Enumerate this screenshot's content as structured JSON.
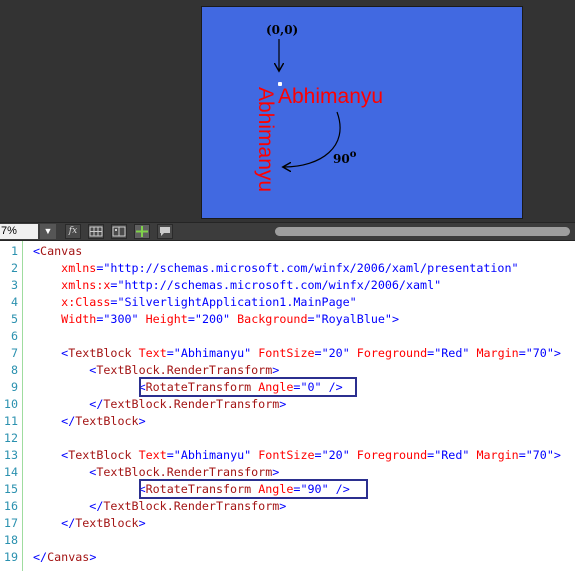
{
  "designer": {
    "origin_label": "(0,0)",
    "text_horizontal": "Abhimanyu",
    "text_vertical": "Abhimanyu",
    "angle_value": "90",
    "angle_degree_mark": "o",
    "colors": {
      "canvas_background": "#4169e1",
      "text_foreground": "#ff0000",
      "annotation": "#000000"
    }
  },
  "toolbar": {
    "zoom_value": "7%",
    "icons": [
      "dropdown-icon",
      "fx-icon",
      "grid-icon",
      "grid-split-icon",
      "snap-icon",
      "comment-icon"
    ]
  },
  "editor": {
    "line_numbers": [
      "1",
      "2",
      "3",
      "4",
      "5",
      "6",
      "7",
      "8",
      "9",
      "10",
      "11",
      "12",
      "13",
      "14",
      "15",
      "16",
      "17",
      "18",
      "19"
    ],
    "lines": [
      {
        "ln": "1",
        "indent": "",
        "tokens": [
          [
            "<",
            "punct"
          ],
          [
            "Canvas",
            "tag"
          ]
        ]
      },
      {
        "ln": "2",
        "indent": "    ",
        "tokens": [
          [
            "xmlns",
            "attr"
          ],
          [
            "=",
            "punct"
          ],
          [
            "\"http://schemas.microsoft.com/winfx/2006/xaml/presentation\"",
            "val"
          ]
        ]
      },
      {
        "ln": "3",
        "indent": "    ",
        "tokens": [
          [
            "xmlns:x",
            "attr"
          ],
          [
            "=",
            "punct"
          ],
          [
            "\"http://schemas.microsoft.com/winfx/2006/xaml\"",
            "val"
          ]
        ]
      },
      {
        "ln": "4",
        "indent": "    ",
        "tokens": [
          [
            "x:Class",
            "attr"
          ],
          [
            "=",
            "punct"
          ],
          [
            "\"SilverlightApplication1.MainPage\"",
            "val"
          ]
        ]
      },
      {
        "ln": "5",
        "indent": "    ",
        "tokens": [
          [
            "Width",
            "attr"
          ],
          [
            "=",
            "punct"
          ],
          [
            "\"300\"",
            "val"
          ],
          [
            " ",
            ""
          ],
          [
            "Height",
            "attr"
          ],
          [
            "=",
            "punct"
          ],
          [
            "\"200\"",
            "val"
          ],
          [
            " ",
            ""
          ],
          [
            "Background",
            "attr"
          ],
          [
            "=",
            "punct"
          ],
          [
            "\"RoyalBlue\"",
            "val"
          ],
          [
            ">",
            "punct"
          ]
        ]
      },
      {
        "ln": "6",
        "indent": "",
        "tokens": []
      },
      {
        "ln": "7",
        "indent": "    ",
        "tokens": [
          [
            "<",
            "punct"
          ],
          [
            "TextBlock",
            "tag"
          ],
          [
            " ",
            ""
          ],
          [
            "Text",
            "attr"
          ],
          [
            "=",
            "punct"
          ],
          [
            "\"Abhimanyu\"",
            "val"
          ],
          [
            " ",
            ""
          ],
          [
            "FontSize",
            "attr"
          ],
          [
            "=",
            "punct"
          ],
          [
            "\"20\"",
            "val"
          ],
          [
            " ",
            ""
          ],
          [
            "Foreground",
            "attr"
          ],
          [
            "=",
            "punct"
          ],
          [
            "\"Red\"",
            "val"
          ],
          [
            " ",
            ""
          ],
          [
            "Margin",
            "attr"
          ],
          [
            "=",
            "punct"
          ],
          [
            "\"70\"",
            "val"
          ],
          [
            ">",
            "punct"
          ]
        ]
      },
      {
        "ln": "8",
        "indent": "        ",
        "tokens": [
          [
            "<",
            "punct"
          ],
          [
            "TextBlock.RenderTransform",
            "tag"
          ],
          [
            ">",
            "punct"
          ]
        ]
      },
      {
        "ln": "9",
        "indent": "               ",
        "tokens": [
          [
            "<",
            "punct"
          ],
          [
            "RotateTransform",
            "tag"
          ],
          [
            " ",
            ""
          ],
          [
            "Angle",
            "attr"
          ],
          [
            "=",
            "punct"
          ],
          [
            "\"0\"",
            "val"
          ],
          [
            " ",
            ""
          ],
          [
            "/>",
            "punct"
          ]
        ]
      },
      {
        "ln": "10",
        "indent": "        ",
        "tokens": [
          [
            "</",
            "punct"
          ],
          [
            "TextBlock.RenderTransform",
            "tag"
          ],
          [
            ">",
            "punct"
          ]
        ]
      },
      {
        "ln": "11",
        "indent": "    ",
        "tokens": [
          [
            "</",
            "punct"
          ],
          [
            "TextBlock",
            "tag"
          ],
          [
            ">",
            "punct"
          ]
        ]
      },
      {
        "ln": "12",
        "indent": "",
        "tokens": []
      },
      {
        "ln": "13",
        "indent": "    ",
        "tokens": [
          [
            "<",
            "punct"
          ],
          [
            "TextBlock",
            "tag"
          ],
          [
            " ",
            ""
          ],
          [
            "Text",
            "attr"
          ],
          [
            "=",
            "punct"
          ],
          [
            "\"Abhimanyu\"",
            "val"
          ],
          [
            " ",
            ""
          ],
          [
            "FontSize",
            "attr"
          ],
          [
            "=",
            "punct"
          ],
          [
            "\"20\"",
            "val"
          ],
          [
            " ",
            ""
          ],
          [
            "Foreground",
            "attr"
          ],
          [
            "=",
            "punct"
          ],
          [
            "\"Red\"",
            "val"
          ],
          [
            " ",
            ""
          ],
          [
            "Margin",
            "attr"
          ],
          [
            "=",
            "punct"
          ],
          [
            "\"70\"",
            "val"
          ],
          [
            ">",
            "punct"
          ]
        ]
      },
      {
        "ln": "14",
        "indent": "        ",
        "tokens": [
          [
            "<",
            "punct"
          ],
          [
            "TextBlock.RenderTransform",
            "tag"
          ],
          [
            ">",
            "punct"
          ]
        ]
      },
      {
        "ln": "15",
        "indent": "               ",
        "tokens": [
          [
            "<",
            "punct"
          ],
          [
            "RotateTransform",
            "tag"
          ],
          [
            " ",
            ""
          ],
          [
            "Angle",
            "attr"
          ],
          [
            "=",
            "punct"
          ],
          [
            "\"90\"",
            "val"
          ],
          [
            " ",
            ""
          ],
          [
            "/>",
            "punct"
          ]
        ]
      },
      {
        "ln": "16",
        "indent": "        ",
        "tokens": [
          [
            "</",
            "punct"
          ],
          [
            "TextBlock.RenderTransform",
            "tag"
          ],
          [
            ">",
            "punct"
          ]
        ]
      },
      {
        "ln": "17",
        "indent": "    ",
        "tokens": [
          [
            "</",
            "punct"
          ],
          [
            "TextBlock",
            "tag"
          ],
          [
            ">",
            "punct"
          ]
        ]
      },
      {
        "ln": "18",
        "indent": "",
        "tokens": []
      },
      {
        "ln": "19",
        "indent": "",
        "tokens": [
          [
            "</",
            "punct"
          ],
          [
            "Canvas",
            "tag"
          ],
          [
            ">",
            "punct"
          ]
        ]
      }
    ],
    "highlighted_lines": [
      "9",
      "15"
    ]
  }
}
